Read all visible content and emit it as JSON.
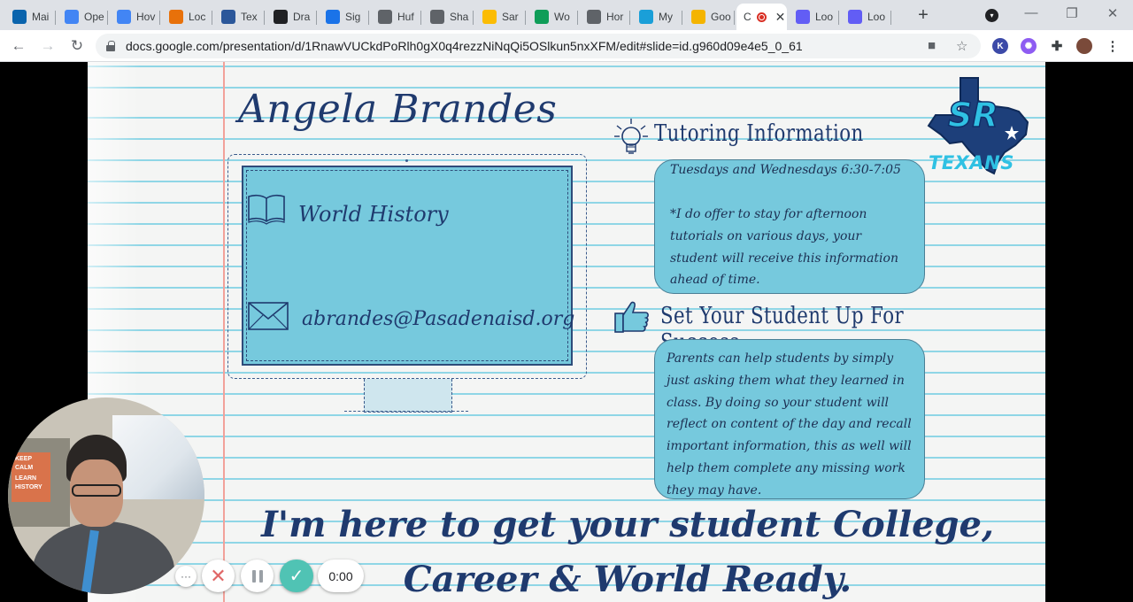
{
  "browser": {
    "tabs": [
      {
        "label": "Mai",
        "icon": "outlook-icon",
        "color": "#0a64ad"
      },
      {
        "label": "Ope",
        "icon": "docs-icon",
        "color": "#4285f4"
      },
      {
        "label": "Hov",
        "icon": "docs-icon",
        "color": "#4285f4"
      },
      {
        "label": "Loc",
        "icon": "app-icon",
        "color": "#e8710a"
      },
      {
        "label": "Tex",
        "icon": "word-icon",
        "color": "#2b579a"
      },
      {
        "label": "Dra",
        "icon": "s-icon",
        "color": "#202124"
      },
      {
        "label": "Sig",
        "icon": "signal-icon",
        "color": "#1a73e8"
      },
      {
        "label": "Huf",
        "icon": "globe-icon",
        "color": "#5f6368"
      },
      {
        "label": "Sha",
        "icon": "globe-icon",
        "color": "#5f6368"
      },
      {
        "label": "Sar",
        "icon": "drive-icon",
        "color": "#fbbc04"
      },
      {
        "label": "Wo",
        "icon": "sheets-plus-icon",
        "color": "#0f9d58"
      },
      {
        "label": "Hor",
        "icon": "chrome-icon",
        "color": "#5f6368"
      },
      {
        "label": "My",
        "icon": "cloud-icon",
        "color": "#1a9fd8"
      },
      {
        "label": "Goo",
        "icon": "slides-icon",
        "color": "#f4b400"
      },
      {
        "label": "C",
        "icon": "recording-icon",
        "color": "#d93025"
      },
      {
        "label": "Loo",
        "icon": "loom-icon",
        "color": "#625df5"
      },
      {
        "label": "Loo",
        "icon": "loom-icon",
        "color": "#625df5"
      }
    ],
    "url": "docs.google.com/presentation/d/1RnawVUCkdPoRlh0gX0q4rezzNiNqQi5OSlkun5nxXFM/edit#slide=id.g960d09e4e5_0_61",
    "new_tab": "+",
    "profile_k": "K"
  },
  "slide": {
    "name": "Angela Brandes",
    "subject": "World History",
    "email": "abrandes@Pasadenaisd.org",
    "tutoring_heading": "Tutoring Information",
    "tutoring_schedule": "Tuesdays and Wednesdays 6:30-7:05",
    "tutoring_note": "*I do offer to stay for afternoon tutorials on various days, your student will receive this information ahead of time.",
    "success_heading": "Set Your Student Up For Success",
    "success_text": "Parents can help students by simply just asking them what they learned in class. By doing so your student will reflect on content of the day and recall important information,  this as well will help them complete any missing work they may have.",
    "logo_initials": "SR",
    "logo_text": "TEXANS",
    "banner": "I'm here to get your student College, Career & World Ready.",
    "colors": {
      "accent": "#76c9dd",
      "ink": "#1f3a6e",
      "logo": "#2fc1e3"
    }
  },
  "recorder": {
    "more": "···",
    "cancel": "✕",
    "done": "✓",
    "timer": "0:00",
    "poster_lines": [
      "KEEP",
      "CALM",
      "LEARN",
      "HISTORY"
    ]
  }
}
